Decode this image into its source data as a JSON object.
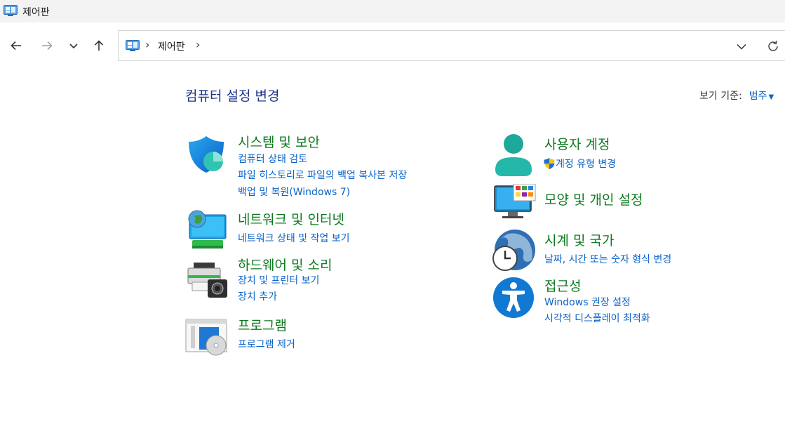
{
  "window": {
    "title": "제어판"
  },
  "address": {
    "crumbs": [
      "제어판"
    ]
  },
  "main": {
    "heading": "컴퓨터 설정 변경",
    "view_by": {
      "label": "보기 기준:",
      "value": "범주"
    }
  },
  "categories": {
    "system_security": {
      "title": "시스템 및 보안",
      "links": [
        "컴퓨터 상태 검토",
        "파일 히스토리로 파일의 백업 복사본 저장",
        "백업 및 복원(Windows 7)"
      ]
    },
    "network": {
      "title": "네트워크 및 인터넷",
      "links": [
        "네트워크 상태 및 작업 보기"
      ]
    },
    "hardware": {
      "title": "하드웨어 및 소리",
      "links": [
        "장치 및 프린터 보기",
        "장치 추가"
      ]
    },
    "programs": {
      "title": "프로그램",
      "links": [
        "프로그램 제거"
      ]
    },
    "user_accounts": {
      "title": "사용자 계정",
      "links": [
        "계정 유형 변경"
      ]
    },
    "appearance": {
      "title": "모양 및 개인 설정",
      "links": []
    },
    "clock_region": {
      "title": "시계 및 국가",
      "links": [
        "날짜, 시간 또는 숫자 형식 변경"
      ]
    },
    "ease_of_access": {
      "title": "접근성",
      "links": [
        "Windows 권장 설정",
        "시각적 디스플레이 최적화"
      ]
    }
  }
}
